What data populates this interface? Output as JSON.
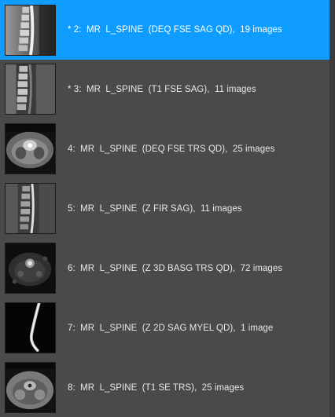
{
  "series_list": {
    "items": [
      {
        "label": "* 2:  MR  L_SPINE  (DEQ FSE SAG QD),  19 images",
        "thumb": "sagittal-lumbar-spine-t2-thumbnail",
        "selected": true
      },
      {
        "label": "* 3:  MR  L_SPINE  (T1 FSE SAG),  11 images",
        "thumb": "sagittal-lumbar-spine-t1-thumbnail",
        "selected": false
      },
      {
        "label": "4:  MR  L_SPINE  (DEQ FSE TRS QD),  25 images",
        "thumb": "axial-lumbar-spine-thumbnail",
        "selected": false
      },
      {
        "label": "5:  MR  L_SPINE  (Z FIR SAG),  11 images",
        "thumb": "sagittal-stir-spine-thumbnail",
        "selected": false
      },
      {
        "label": "6:  MR  L_SPINE  (Z 3D BASG TRS QD),  72 images",
        "thumb": "axial-3d-spine-thumbnail",
        "selected": false
      },
      {
        "label": "7:  MR  L_SPINE  (Z 2D SAG MYEL QD),  1 image",
        "thumb": "myelogram-thumbnail",
        "selected": false
      },
      {
        "label": "8:  MR  L_SPINE  (T1 SE TRS),  25 images",
        "thumb": "axial-t1-spine-thumbnail",
        "selected": false
      }
    ]
  },
  "colors": {
    "panel_background": "#4a4a4a",
    "selected_background": "#0f9cff",
    "text": "#e8e8e8"
  }
}
